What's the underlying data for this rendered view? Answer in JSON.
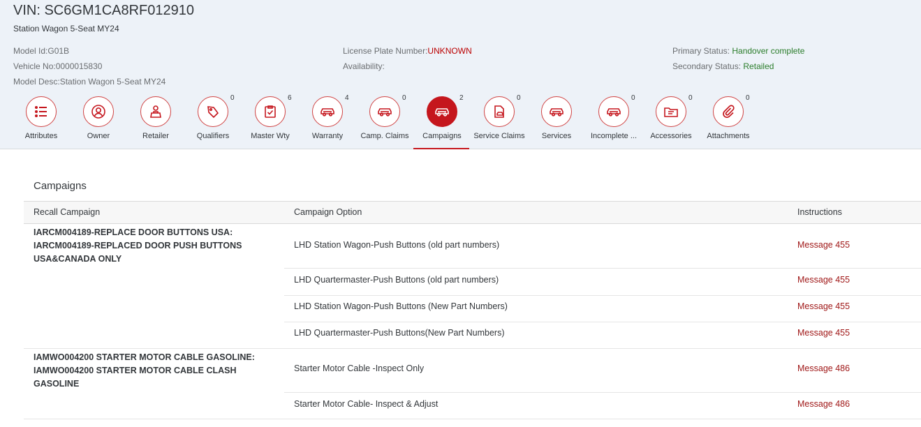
{
  "header": {
    "vin": "VIN: SC6GM1CA8RF012910",
    "subtitle": "Station Wagon 5-Seat MY24",
    "model_id": "Model Id:G01B",
    "vehicle_no": "Vehicle No:0000015830",
    "model_desc": "Model Desc:Station Wagon 5-Seat MY24",
    "license_label": "License Plate Number:",
    "license_value": "UNKNOWN",
    "availability_label": "Availability:",
    "primary_status_label": "Primary Status: ",
    "primary_status_value": "Handover complete",
    "secondary_status_label": "Secondary Status: ",
    "secondary_status_value": "Retailed"
  },
  "tabs": [
    {
      "label": "Attributes",
      "count": "",
      "icon": "list-icon"
    },
    {
      "label": "Owner",
      "count": "",
      "icon": "person-icon"
    },
    {
      "label": "Retailer",
      "count": "",
      "icon": "retailer-icon"
    },
    {
      "label": "Qualifiers",
      "count": "0",
      "icon": "tag-icon"
    },
    {
      "label": "Master Wty",
      "count": "6",
      "icon": "checklist-icon"
    },
    {
      "label": "Warranty",
      "count": "4",
      "icon": "car-icon"
    },
    {
      "label": "Camp. Claims",
      "count": "0",
      "icon": "car-icon"
    },
    {
      "label": "Campaigns",
      "count": "2",
      "icon": "car-icon"
    },
    {
      "label": "Service Claims",
      "count": "0",
      "icon": "service-claim-icon"
    },
    {
      "label": "Services",
      "count": "",
      "icon": "car-icon"
    },
    {
      "label": "Incomplete ...",
      "count": "0",
      "icon": "car-icon"
    },
    {
      "label": "Accessories",
      "count": "0",
      "icon": "folder-icon"
    },
    {
      "label": "Attachments",
      "count": "0",
      "icon": "paperclip-icon"
    }
  ],
  "active_tab": "Campaigns",
  "campaigns": {
    "title": "Campaigns",
    "columns": [
      "Recall Campaign",
      "Campaign Option",
      "Instructions"
    ],
    "groups": [
      {
        "campaign": "IARCM004189-REPLACE DOOR BUTTONS USA: IARCM004189-REPLACED DOOR PUSH BUTTONS USA&CANADA ONLY",
        "options": [
          {
            "option": "LHD Station Wagon-Push Buttons (old part numbers)",
            "instruction": "Message 455"
          },
          {
            "option": "LHD Quartermaster-Push Buttons (old part numbers)",
            "instruction": "Message 455"
          },
          {
            "option": "LHD Station Wagon-Push Buttons (New Part Numbers)",
            "instruction": "Message 455"
          },
          {
            "option": "LHD Quartermaster-Push Buttons(New Part Numbers)",
            "instruction": "Message 455"
          }
        ]
      },
      {
        "campaign": "IAMWO004200 STARTER MOTOR CABLE GASOLINE: IAMWO004200 STARTER MOTOR CABLE CLASH GASOLINE",
        "options": [
          {
            "option": "Starter Motor Cable -Inspect Only",
            "instruction": "Message 486"
          },
          {
            "option": "Starter Motor Cable- Inspect & Adjust",
            "instruction": "Message 486"
          }
        ]
      }
    ]
  },
  "colors": {
    "accent": "#c5161d",
    "link": "#a01919",
    "success": "#2b7d2b",
    "header_bg": "#edf2f8"
  }
}
